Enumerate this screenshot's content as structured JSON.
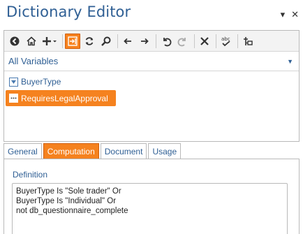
{
  "window": {
    "title": "Dictionary Editor",
    "pin_glyph": "▾",
    "close_glyph": "✕"
  },
  "toolbar": {
    "buttons": [
      {
        "name": "back-icon"
      },
      {
        "name": "home-icon"
      },
      {
        "name": "add-icon"
      },
      {
        "name": "go-to-selection-icon",
        "active": true
      },
      {
        "name": "refresh-icon"
      },
      {
        "name": "search-icon"
      },
      {
        "name": "arrow-left-icon"
      },
      {
        "name": "arrow-right-icon"
      },
      {
        "name": "undo-icon"
      },
      {
        "name": "redo-icon"
      },
      {
        "name": "delete-icon"
      },
      {
        "name": "spell-check-icon"
      },
      {
        "name": "move-icon"
      }
    ]
  },
  "filter": {
    "selected": "All Variables"
  },
  "variables": {
    "items": [
      {
        "label": "BuyerType",
        "icon": "list-variable-icon",
        "selected": false
      },
      {
        "label": "RequiresLegalApproval",
        "icon": "computed-variable-icon",
        "selected": true
      }
    ]
  },
  "tabs": [
    {
      "label": "General",
      "active": false
    },
    {
      "label": "Computation",
      "active": true
    },
    {
      "label": "Document",
      "active": false
    },
    {
      "label": "Usage",
      "active": false
    }
  ],
  "computation": {
    "definition_label": "Definition",
    "definition_text": "BuyerType Is \"Sole trader\" Or\nBuyerType Is \"Individual\" Or\nnot db_questionnaire_complete"
  },
  "colors": {
    "accent": "#f5821f",
    "text_blue": "#2f5f94"
  }
}
